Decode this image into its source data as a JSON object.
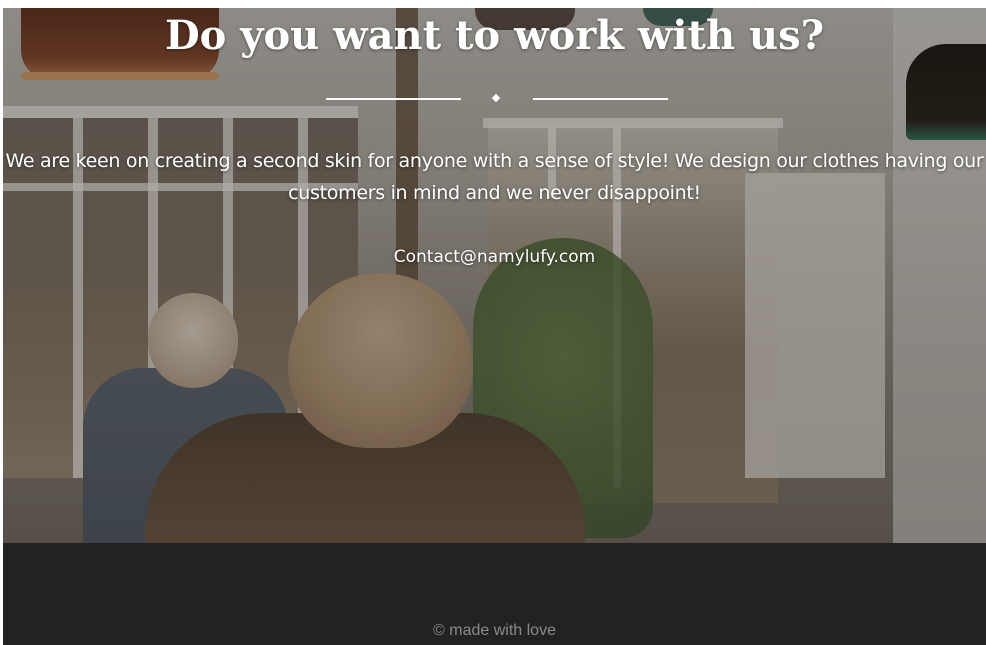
{
  "hero": {
    "title": "Do you want to work with us?",
    "description": "We are keen on creating a second skin for anyone with a sense of style! We design our clothes having our customers in mind and we never disappoint!",
    "contact_email": "Contact@namylufy.com",
    "contact_href": "mailto:Contact@namylufy.com",
    "background_image": "cafe-patrons-photo"
  },
  "footer": {
    "text": "© made with love"
  },
  "colors": {
    "hero_text": "#ffffff",
    "footer_background": "#222222",
    "footer_text": "#8a8a8a"
  }
}
